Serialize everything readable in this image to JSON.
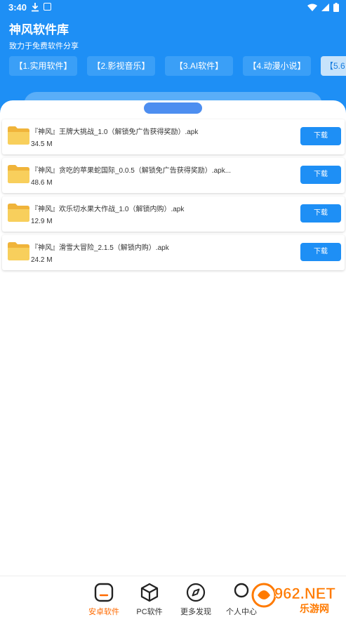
{
  "status_bar": {
    "time": "3:40"
  },
  "header": {
    "title": "神风软件库",
    "subtitle": "致力于免费软件分享"
  },
  "categories": [
    {
      "label": "【1.实用软件】",
      "active": false
    },
    {
      "label": "【2.影视音乐】",
      "active": false
    },
    {
      "label": "【3.AI软件】",
      "active": false
    },
    {
      "label": "【4.动漫小说】",
      "active": false
    },
    {
      "label": "【5.6",
      "active": true
    }
  ],
  "files": [
    {
      "name": "『神风』王牌大挑战_1.0（解锁免广告获得奖励）.apk",
      "size": "34.5 M",
      "button": "下载"
    },
    {
      "name": "『神风』贪吃的苹果蛇国际_0.0.5（解锁免广告获得奖励）.apk...",
      "size": "48.6 M",
      "button": "下载"
    },
    {
      "name": "『神风』欢乐切水果大作战_1.0（解锁内购）.apk",
      "size": "12.9 M",
      "button": "下载"
    },
    {
      "name": "『神风』滑雪大冒险_2.1.5（解锁内购）.apk",
      "size": "24.2 M",
      "button": "下载"
    }
  ],
  "bottom_nav": [
    {
      "label": "安卓软件",
      "icon": "android-box-icon",
      "active": true
    },
    {
      "label": "PC软件",
      "icon": "cube-icon",
      "active": false
    },
    {
      "label": "更多发现",
      "icon": "compass-icon",
      "active": false
    },
    {
      "label": "个人中心",
      "icon": "person-icon",
      "active": false
    }
  ],
  "watermark": {
    "text": "962.NET",
    "subtext": "乐游网"
  },
  "colors": {
    "primary": "#1e8ff5",
    "active_nav": "#ff6a00",
    "folder": "#f7c24a"
  }
}
